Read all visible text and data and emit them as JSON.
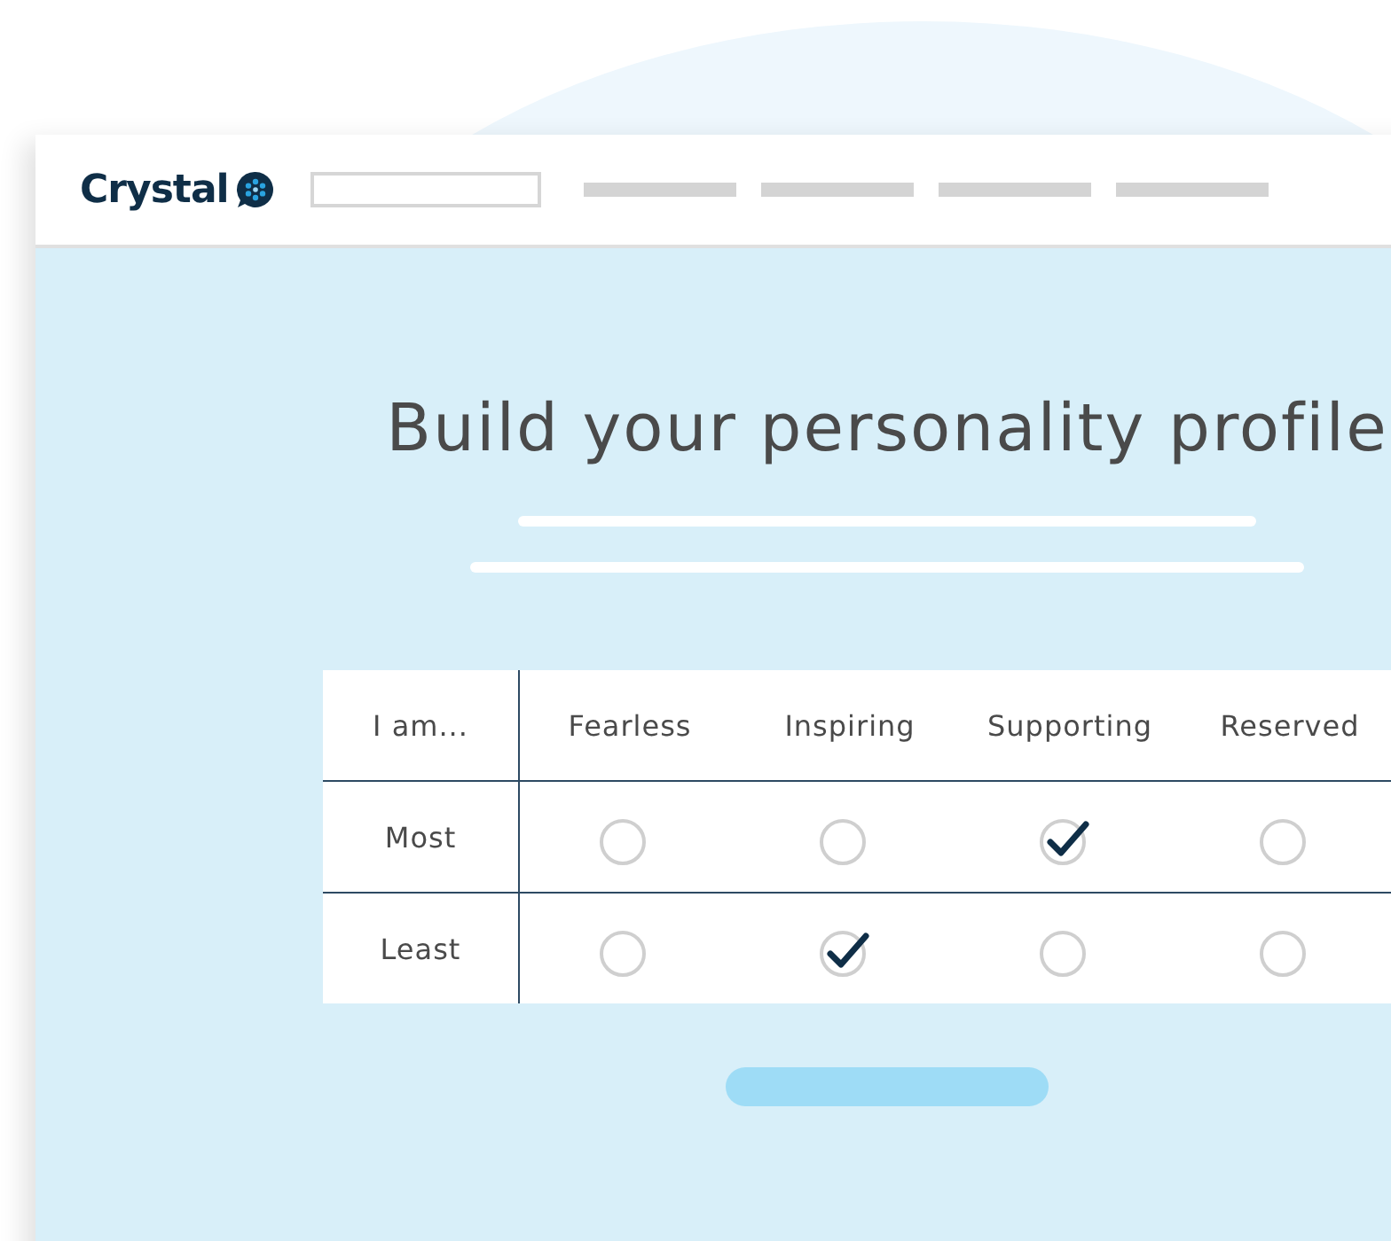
{
  "header": {
    "brand": "Crystal"
  },
  "title": "Build your personality profile",
  "table": {
    "corner": "I am...",
    "columns": [
      "Fearless",
      "Inspiring",
      "Supporting",
      "Reserved"
    ],
    "rows": [
      {
        "label": "Most",
        "options": [
          {
            "selected": false
          },
          {
            "selected": false
          },
          {
            "selected": true
          },
          {
            "selected": false
          }
        ]
      },
      {
        "label": "Least",
        "options": [
          {
            "selected": false
          },
          {
            "selected": true
          },
          {
            "selected": false
          },
          {
            "selected": false
          }
        ]
      }
    ]
  }
}
